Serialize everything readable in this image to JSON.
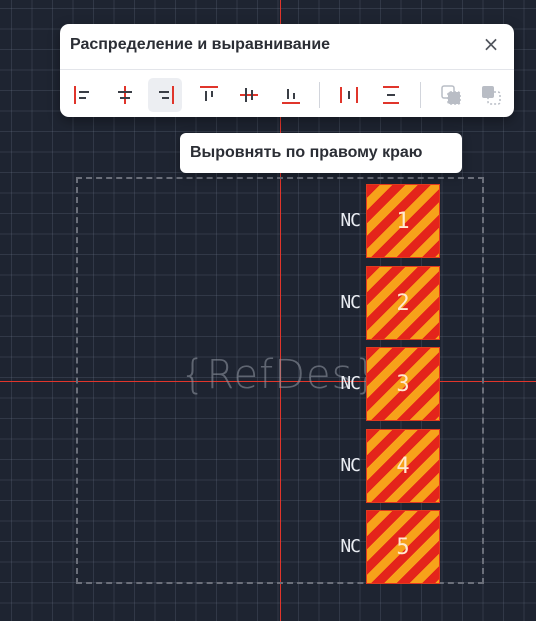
{
  "panel": {
    "title": "Распределение и выравнивание",
    "close_glyph": "×"
  },
  "tools": [
    {
      "name": "align-left-icon",
      "active": false
    },
    {
      "name": "align-center-horizontal-icon",
      "active": false
    },
    {
      "name": "align-right-icon",
      "active": true
    },
    {
      "name": "align-top-icon",
      "active": false
    },
    {
      "name": "align-center-vertical-icon",
      "active": false
    },
    {
      "name": "align-bottom-icon",
      "active": false
    },
    {
      "name": "distribute-horizontal-icon",
      "active": false
    },
    {
      "name": "distribute-vertical-icon",
      "active": false
    },
    {
      "name": "bring-to-front-icon",
      "active": false,
      "disabled": true
    },
    {
      "name": "send-to-back-icon",
      "active": false,
      "disabled": true
    }
  ],
  "tooltip": {
    "text": "Выровнять по правому краю"
  },
  "footprint": {
    "refdes": "{RefDes}",
    "pins": [
      {
        "label": "NC",
        "number": "1"
      },
      {
        "label": "NC",
        "number": "2"
      },
      {
        "label": "NC",
        "number": "3"
      },
      {
        "label": "NC",
        "number": "4"
      },
      {
        "label": "NC",
        "number": "5"
      }
    ]
  },
  "colors": {
    "canvas": "#1e2431",
    "crosshair": "#e0352b",
    "pad_stripe_a": "#e4241b",
    "pad_stripe_b": "#f7a21a",
    "toolbar_icon_red": "#e0352b",
    "toolbar_icon_dark": "#3a3e46",
    "disabled_icon": "#b9bdc5"
  }
}
